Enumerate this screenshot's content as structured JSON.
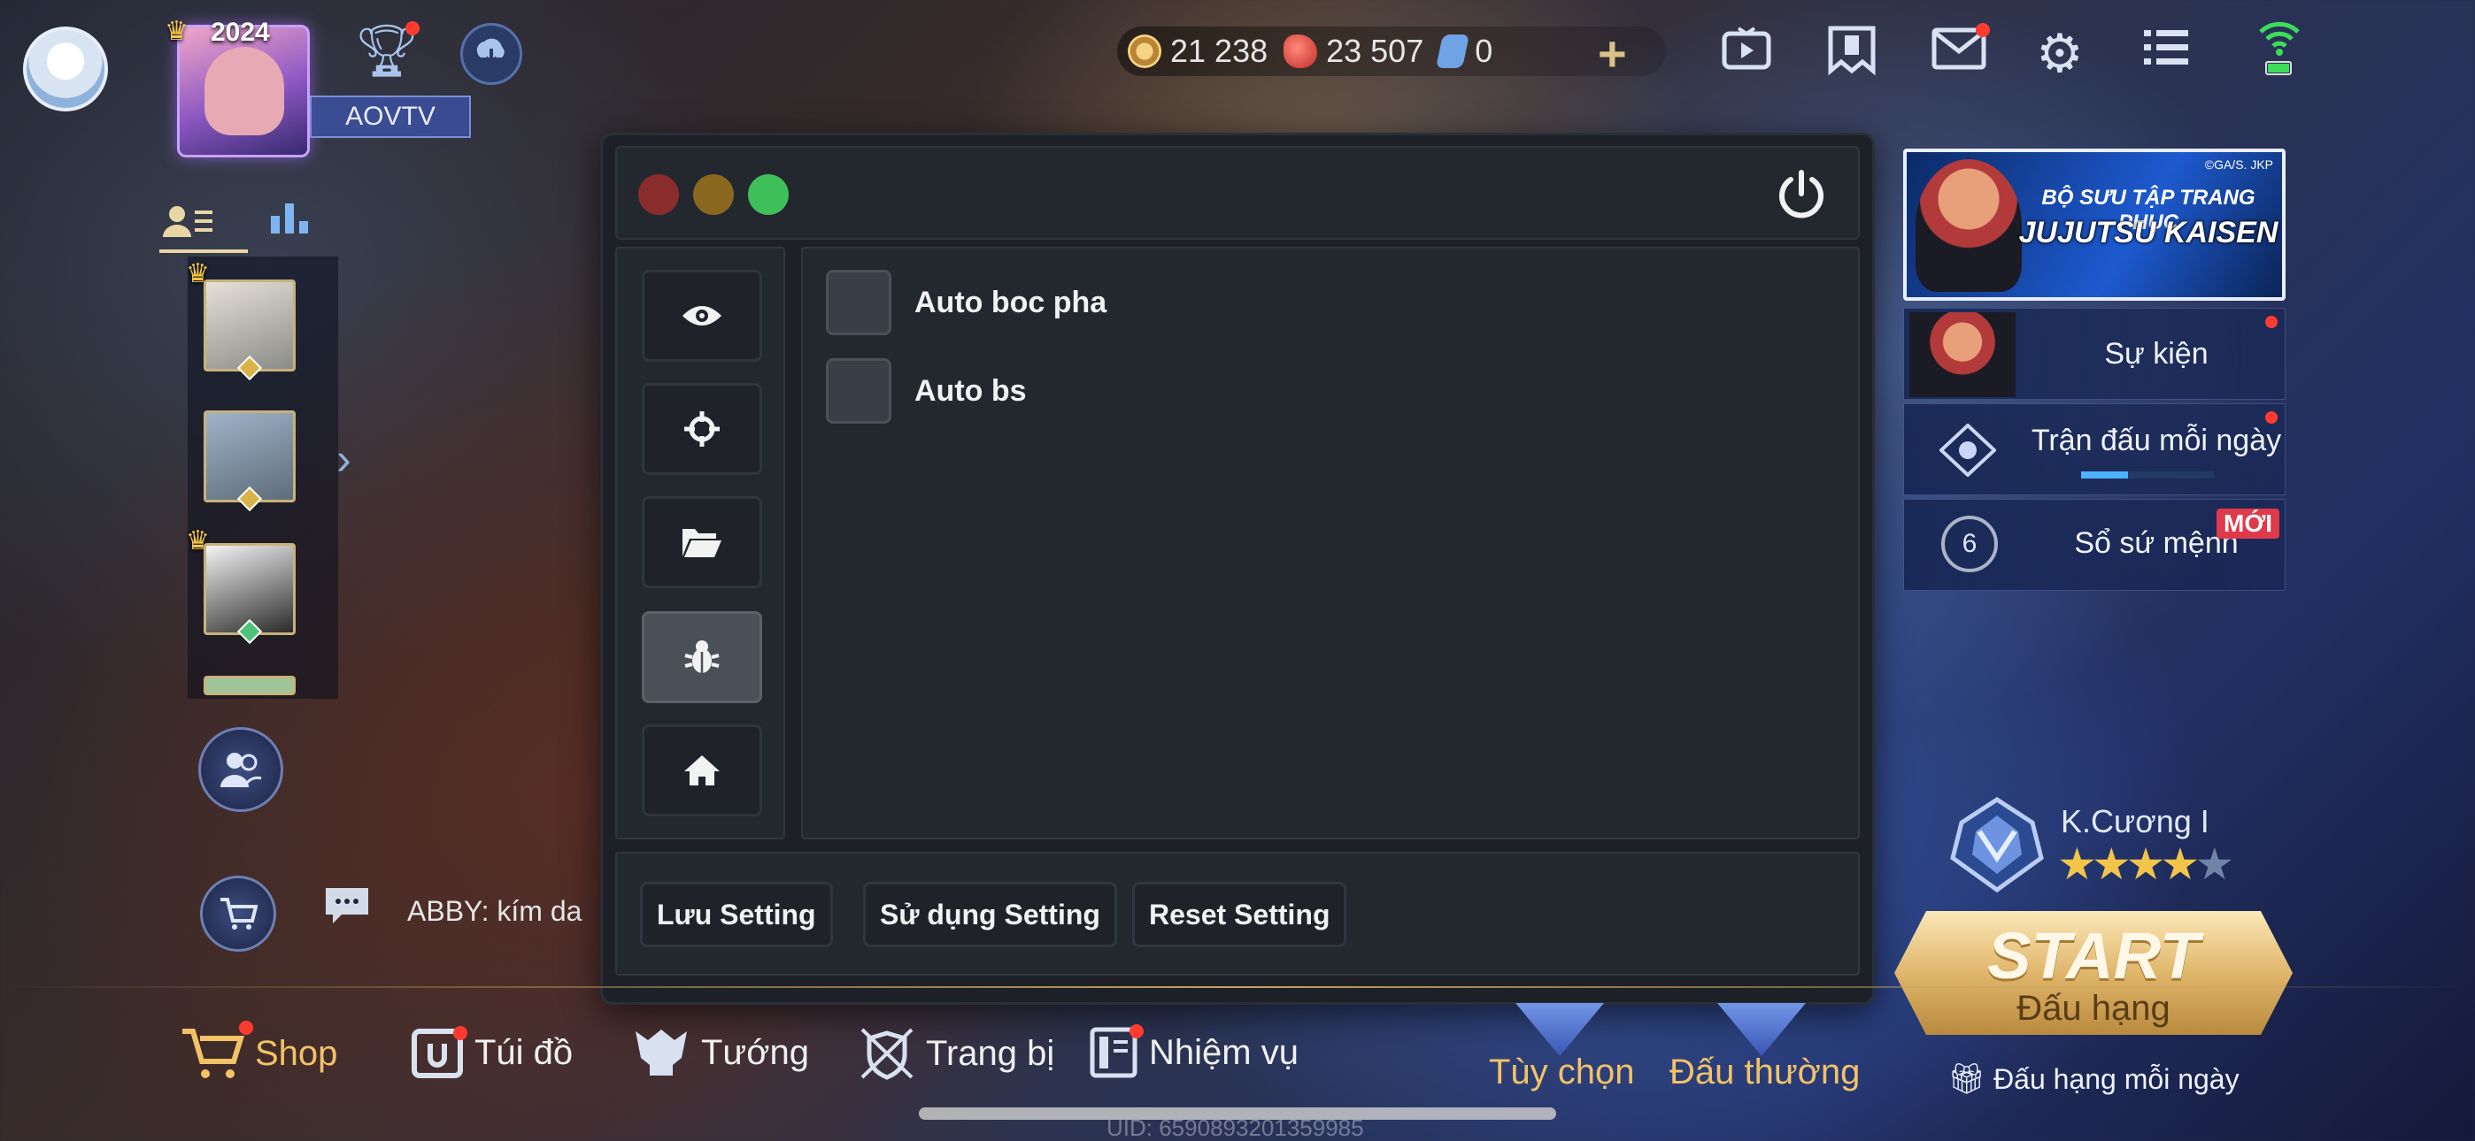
{
  "top": {
    "year_badge": "2024",
    "player_name": "AOVTV",
    "currencies": [
      {
        "icon": "gold-coin-icon",
        "value": "21 238"
      },
      {
        "icon": "ruby-icon",
        "value": "23 507"
      },
      {
        "icon": "voucher-icon",
        "value": "0"
      }
    ],
    "plus": "+"
  },
  "left": {
    "chat_text": "ABBY: kím da"
  },
  "mod_menu": {
    "options": [
      {
        "label": "Auto boc pha",
        "checked": false
      },
      {
        "label": "Auto bs",
        "checked": false
      }
    ],
    "footer_buttons": {
      "save": "Lưu Setting",
      "use": "Sử dụng Setting",
      "reset": "Reset Setting"
    },
    "colors": {
      "close": "#8b2c2c",
      "minimize": "#8a6820",
      "maximize": "#3fbf5a"
    }
  },
  "right": {
    "banner": {
      "copyright": "©GA/S. JKP",
      "line1": "BỘ SƯU TẬP TRANG PHỤC",
      "line2": "JUJUTSU KAISEN"
    },
    "events": [
      {
        "label": "Sự kiện"
      },
      {
        "label": "Trận đấu mỗi ngày",
        "progress": 0.35
      },
      {
        "label": "Sổ sứ mệnh",
        "badge": "MỚI",
        "number": "6"
      }
    ],
    "rank_name": "K.Cương I",
    "rank_stars": 4,
    "rank_stars_total": 5,
    "start": {
      "big": "START",
      "small": "Đấu hạng"
    },
    "daily_rank": "Đấu hạng mỗi ngày"
  },
  "bottom_nav": {
    "shop": "Shop",
    "bag": "Túi đồ",
    "heroes": "Tướng",
    "equipment": "Trang bị",
    "missions": "Nhiệm vụ",
    "custom": "Tùy chọn",
    "normal": "Đấu thường"
  },
  "uid": "UID: 6590893201359985"
}
